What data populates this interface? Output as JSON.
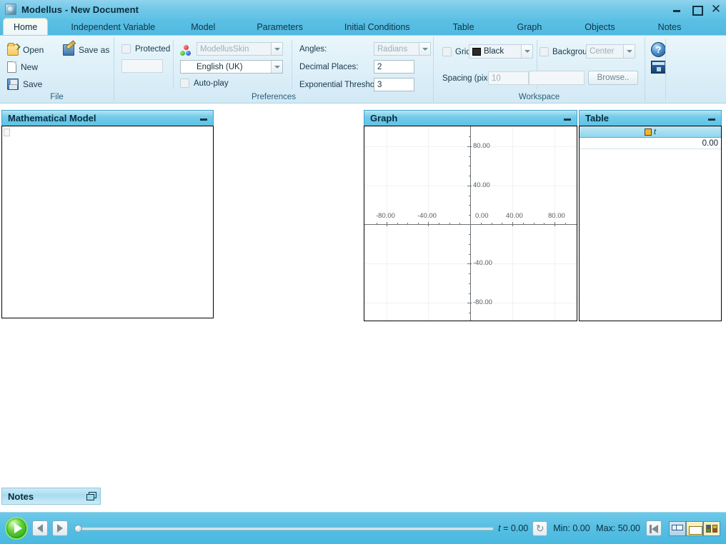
{
  "window": {
    "app_name": "Modellus",
    "document_name": "New Document",
    "title": "Modellus - New Document",
    "icon": "modellus-app-icon",
    "buttons": {
      "minimize": "minimize-icon",
      "maximize": "maximize-icon",
      "close": "close-icon"
    }
  },
  "ribbon": {
    "tabs": [
      {
        "label": "Home",
        "active": true
      },
      {
        "label": "Independent Variable",
        "active": false
      },
      {
        "label": "Model",
        "active": false
      },
      {
        "label": "Parameters",
        "active": false
      },
      {
        "label": "Initial Conditions",
        "active": false
      },
      {
        "label": "Table",
        "active": false
      },
      {
        "label": "Graph",
        "active": false
      },
      {
        "label": "Objects",
        "active": false
      },
      {
        "label": "Notes",
        "active": false
      }
    ],
    "groups": {
      "file": {
        "label": "File",
        "items": [
          {
            "label": "Open",
            "icon": "open-folder-icon"
          },
          {
            "label": "New",
            "icon": "new-document-icon"
          },
          {
            "label": "Save",
            "icon": "save-disk-icon"
          },
          {
            "label": "Save as",
            "icon": "save-as-icon"
          }
        ]
      },
      "preferences": {
        "label": "Preferences",
        "protected_label": "Protected",
        "protected_checked": false,
        "password_value": "",
        "password_placeholder": "",
        "skin_value": "ModellusSkin",
        "skin_icon": "color-dots-icon",
        "language_value": "English (UK)",
        "language_icon": "uk-flag-icon",
        "autoplay_label": "Auto-play",
        "autoplay_checked": false,
        "angles_label": "Angles:",
        "angles_value": "Radians",
        "decimal_places_label": "Decimal Places:",
        "decimal_places_value": "2",
        "exponential_threshold_label": "Exponential Threshold:",
        "exponential_threshold_value": "3"
      },
      "workspace": {
        "label": "Workspace",
        "grid_label": "Grid",
        "grid_checked": false,
        "grid_color_value": "Black",
        "grid_color_hex": "#2b2b2b",
        "spacing_label": "Spacing (pixels):",
        "spacing_value": "10",
        "background_label": "Background",
        "background_checked": false,
        "background_position_value": "Center",
        "background_path_value": "",
        "browse_label": "Browse.."
      },
      "help": {
        "help_icon": "help-question-icon",
        "help_glyph": "?",
        "video_icon": "video-help-icon"
      }
    }
  },
  "panels": {
    "model": {
      "title": "Mathematical Model",
      "minimize_icon": "minimize-panel-icon",
      "content": ""
    },
    "graph": {
      "title": "Graph",
      "minimize_icon": "minimize-panel-icon"
    },
    "table": {
      "title": "Table",
      "minimize_icon": "minimize-panel-icon",
      "columns": [
        {
          "name": "t",
          "swatch_hex": "#f3b331"
        }
      ],
      "rows": [
        {
          "t": "0.00"
        }
      ]
    },
    "notes": {
      "title": "Notes",
      "restore_icon": "restore-panel-icon"
    }
  },
  "chart_data": {
    "type": "scatter",
    "title": "Graph",
    "series": [],
    "xlabel": "",
    "ylabel": "",
    "xlim": [
      -110,
      110
    ],
    "ylim": [
      -110,
      110
    ],
    "xticks": [
      "-80.00",
      "-40.00",
      "0.00",
      "40.00",
      "80.00"
    ],
    "yticks": [
      "80.00",
      "40.00",
      "-40.00",
      "-80.00"
    ],
    "xtick_values": [
      -80,
      -40,
      0,
      40,
      80
    ],
    "ytick_values": [
      80,
      40,
      -40,
      -80
    ],
    "grid": true,
    "legend": "none",
    "axis_color": "#6d7276",
    "grid_color": "#eef1f4"
  },
  "controls": {
    "play_button": "play-icon",
    "step_back_button": "step-back-icon",
    "step_forward_button": "step-forward-icon",
    "slider_value": 0,
    "slider_min": 0,
    "slider_max": 50,
    "time_variable": "t",
    "time_equals": "=",
    "time_value": "0.00",
    "time_readout": "t  = 0.00",
    "loop_button": "loop-refresh-icon",
    "range_label": "Min: 0.00 Max: 50.00",
    "min_label": "Min: 0.00",
    "max_label": "Max: 50.00",
    "rewind_button": "rewind-to-start-icon",
    "right_buttons": [
      {
        "name": "arrange-windows-icon"
      },
      {
        "name": "file-explorer-icon"
      },
      {
        "name": "color-grid-icon"
      }
    ]
  }
}
